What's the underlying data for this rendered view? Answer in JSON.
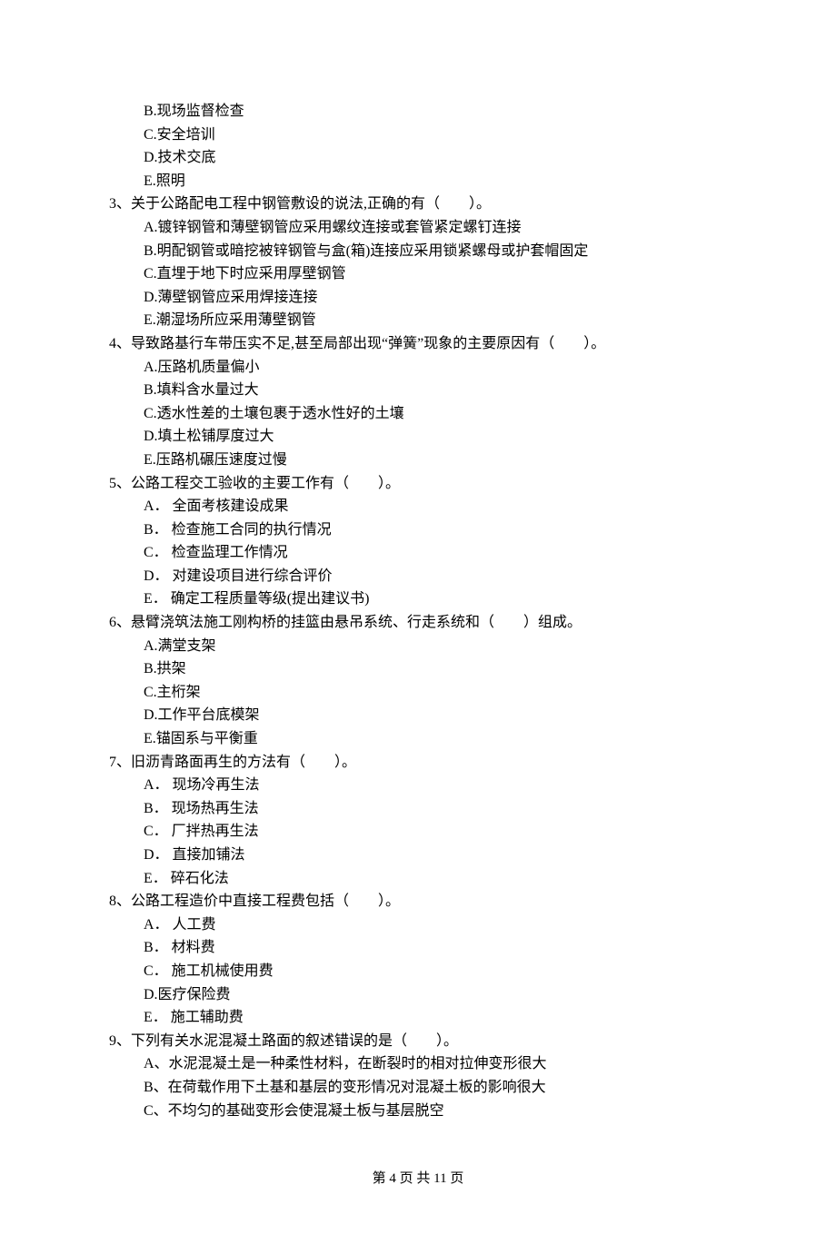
{
  "partial_options_before": [
    "B.现场监督检查",
    "C.安全培训",
    "D.技术交底",
    "E.照明"
  ],
  "questions": [
    {
      "num": "3、",
      "text": "关于公路配电工程中钢管敷设的说法,正确的有（　　）。",
      "options": [
        "A.镀锌钢管和薄壁钢管应采用螺纹连接或套管紧定螺钉连接",
        "B.明配钢管或暗挖被锌钢管与盒(箱)连接应采用锁紧螺母或护套帽固定",
        "C.直埋于地下时应采用厚壁钢管",
        "D.薄壁钢管应采用焊接连接",
        "E.潮湿场所应采用薄壁钢管"
      ]
    },
    {
      "num": "4、",
      "text": "导致路基行车带压实不足,甚至局部出现“弹簧”现象的主要原因有（　　）。",
      "options": [
        "A.压路机质量偏小",
        "B.填料含水量过大",
        "C.透水性差的土壤包裹于透水性好的土壤",
        "D.填土松铺厚度过大",
        "E.压路机碾压速度过慢"
      ]
    },
    {
      "num": "5、",
      "text": "公路工程交工验收的主要工作有（　　）。",
      "options": [
        "A． 全面考核建设成果",
        "B． 检查施工合同的执行情况",
        "C． 检查监理工作情况",
        "D． 对建设项目进行综合评价",
        "E． 确定工程质量等级(提出建议书)"
      ]
    },
    {
      "num": "6、",
      "text": "悬臂浇筑法施工刚构桥的挂篮由悬吊系统、行走系统和（　　）组成。",
      "options": [
        "A.满堂支架",
        "B.拱架",
        "C.主桁架",
        "D.工作平台底模架",
        "E.锚固系与平衡重"
      ]
    },
    {
      "num": "7、",
      "text": "旧沥青路面再生的方法有（　　）。",
      "options": [
        "A． 现场冷再生法",
        "B． 现场热再生法",
        "C． 厂拌热再生法",
        "D． 直接加铺法",
        "E． 碎石化法"
      ]
    },
    {
      "num": "8、",
      "text": "公路工程造价中直接工程费包括（　　）。",
      "options": [
        "A． 人工费",
        "B． 材料费",
        "C． 施工机械使用费",
        "D.医疗保险费",
        "E． 施工辅助费"
      ]
    },
    {
      "num": "9、",
      "text": "下列有关水泥混凝土路面的叙述错误的是（　　）。",
      "options": [
        "A、水泥混凝土是一种柔性材料，在断裂时的相对拉伸变形很大",
        "B、在荷载作用下土基和基层的变形情况对混凝土板的影响很大",
        "C、不均匀的基础变形会使混凝土板与基层脱空"
      ]
    }
  ],
  "footer": "第 4 页 共 11 页"
}
